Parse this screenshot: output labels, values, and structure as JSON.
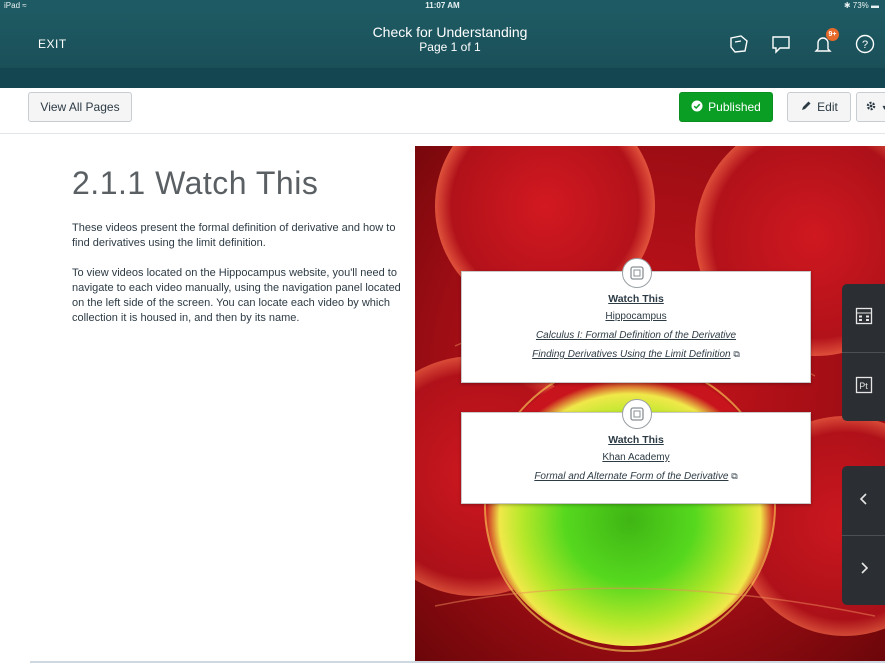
{
  "status": {
    "device": "iPad",
    "time": "11:07 AM",
    "battery": "73%"
  },
  "header": {
    "exit_label": "EXIT",
    "title": "Check for Understanding",
    "subtitle": "Page 1 of 1",
    "notification_count": "9+"
  },
  "toolbar": {
    "view_all_label": "View All Pages",
    "published_label": "Published",
    "edit_label": "Edit"
  },
  "page": {
    "heading": "2.1.1 Watch This",
    "paragraphs": [
      "These videos present the formal definition of derivative and how to find derivatives using the limit definition.",
      "To view videos located on the Hippocampus website, you'll need to navigate to each video manually, using the navigation panel located on the left side of the screen. You can locate each video by which collection it is housed in, and then by its name."
    ]
  },
  "cards": [
    {
      "title": "Watch This",
      "source": "Hippocampus",
      "links": [
        "Calculus I: Formal Definition of the Derivative",
        "Finding Derivatives Using the Limit Definition"
      ]
    },
    {
      "title": "Watch This",
      "source": "Khan Academy",
      "links": [
        "Formal and Alternate Form of the Derivative"
      ]
    }
  ],
  "colors": {
    "header": "#1e5a63",
    "published": "#0b9e24",
    "hero_red": "#b5121b",
    "hero_green": "#4cd21c",
    "side_panel": "#2b2f33"
  },
  "icons": [
    "notes-icon",
    "comment-icon",
    "bell-icon",
    "help-icon",
    "gear-icon",
    "pencil-icon",
    "check-circle-icon",
    "video-icon",
    "external-link-icon",
    "calculator-icon",
    "pt-icon",
    "chevron-left-icon",
    "chevron-right-icon"
  ]
}
